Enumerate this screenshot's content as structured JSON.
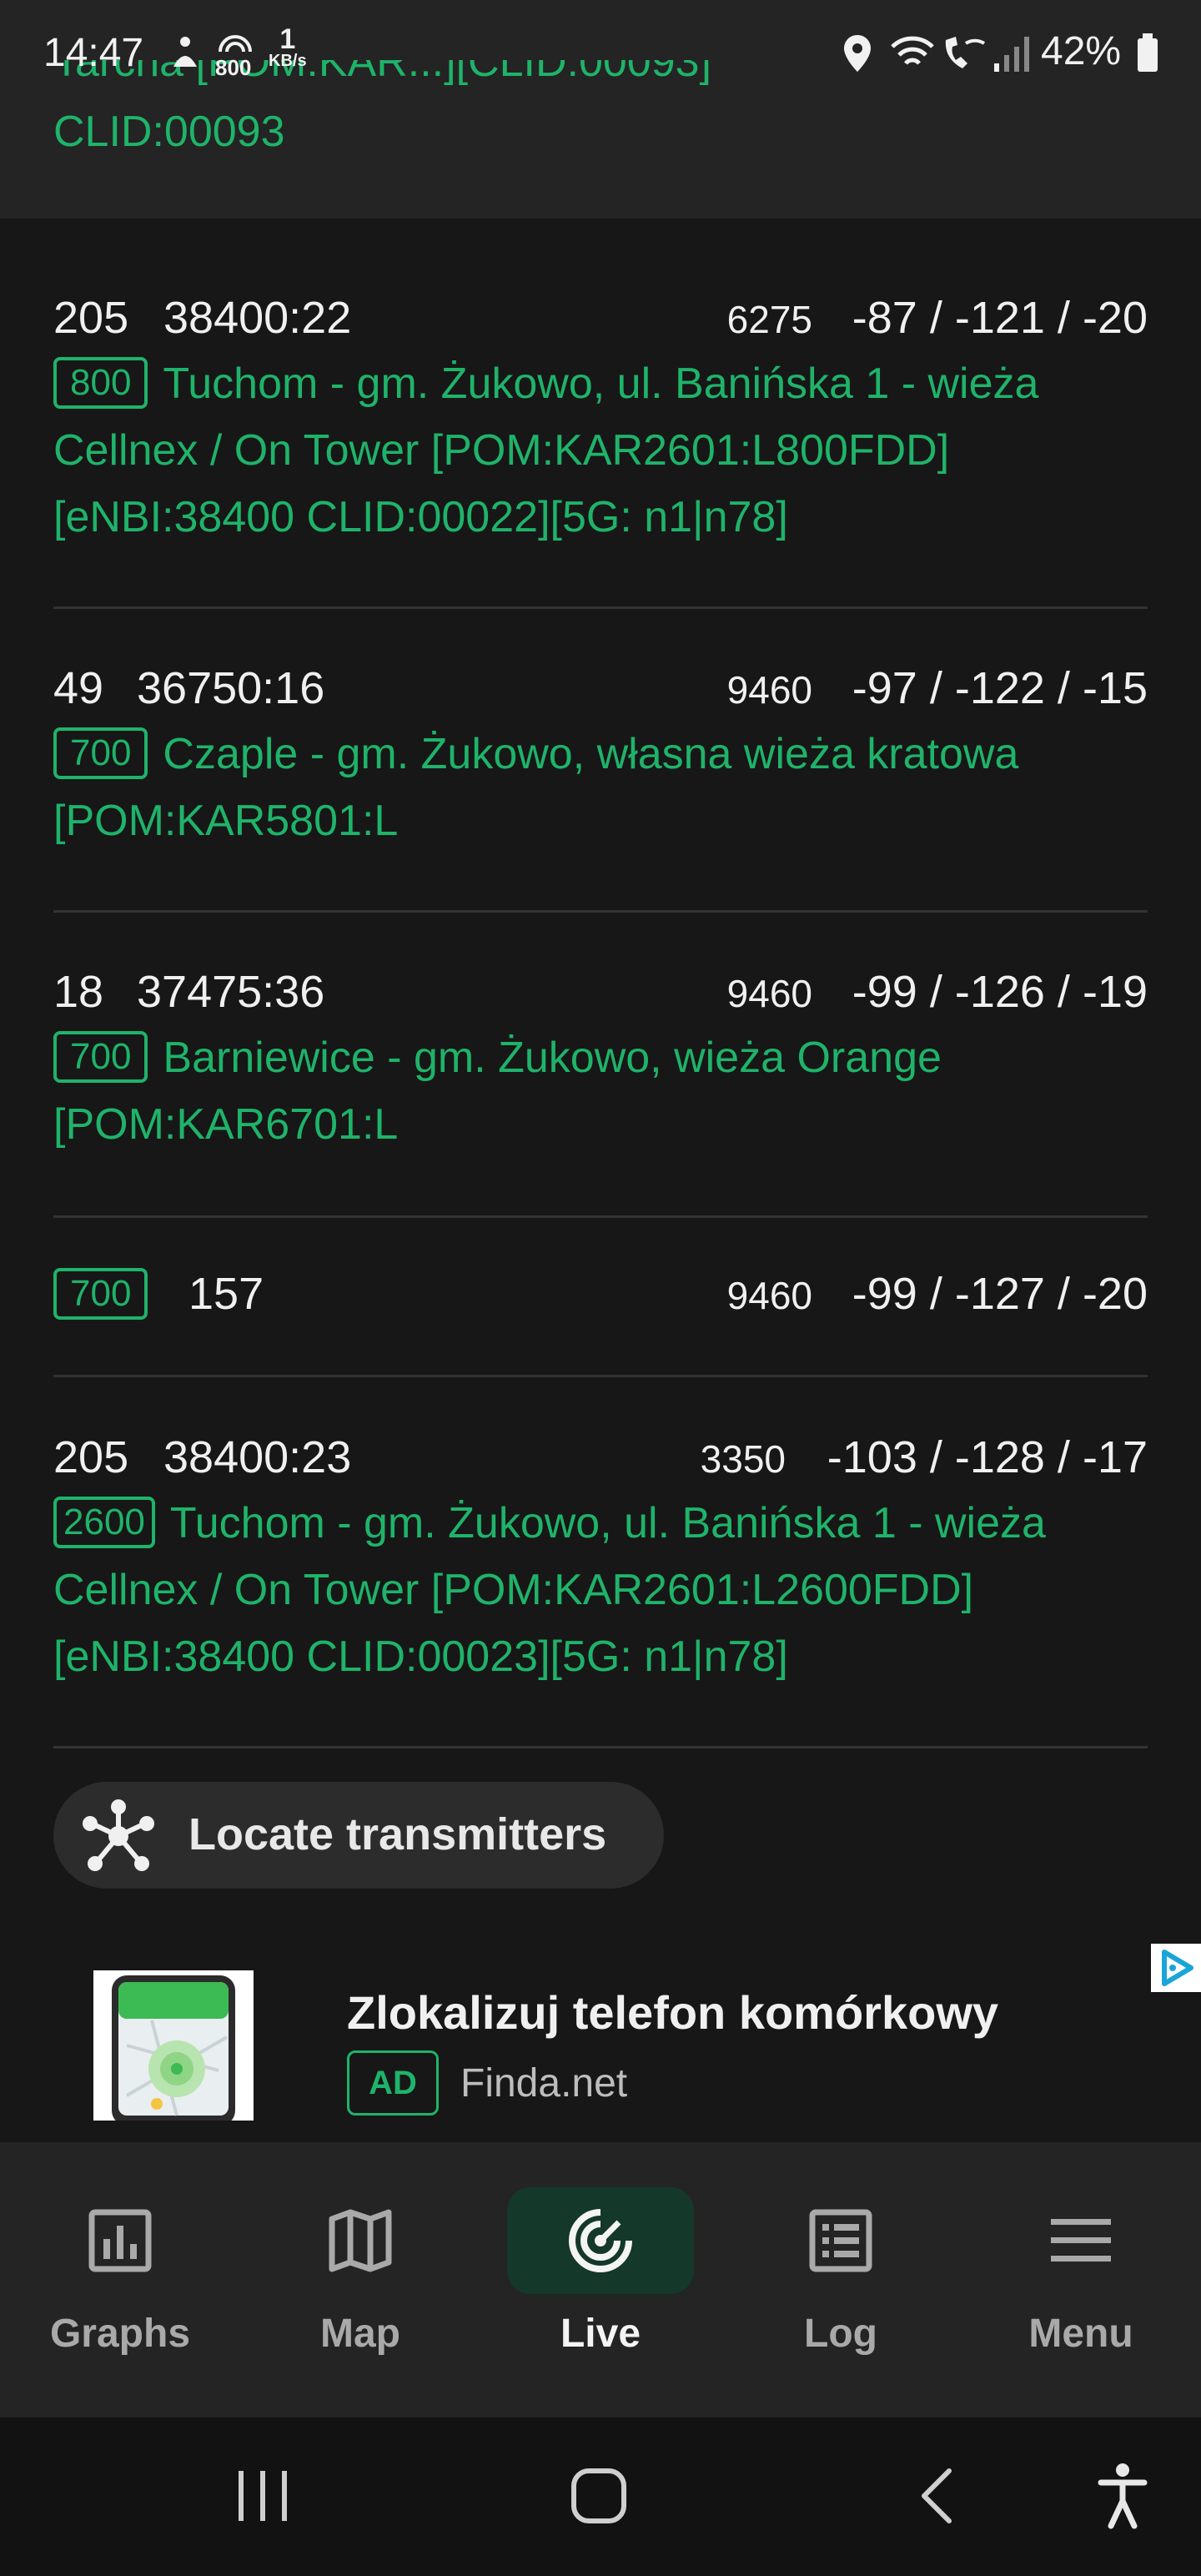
{
  "status_bar": {
    "time": "14:47",
    "net_speed_value": "1",
    "net_speed_unit": "KB/s",
    "signal_label": "800",
    "battery": "42%"
  },
  "top_card": {
    "clid_text": "CLID:00093"
  },
  "cells": [
    {
      "pci": "205",
      "cid": "38400:22",
      "earfcn": "6275",
      "signal": "-87 / -121 / -20",
      "band": "800",
      "site": "Tuchom - gm. Żukowo, ul. Banińska 1 - wieża Cellnex / On Tower [POM:KAR2601:L800FDD] [eNBI:38400 CLID:00022][5G: n1|n78]"
    },
    {
      "pci": "49",
      "cid": "36750:16",
      "earfcn": "9460",
      "signal": "-97 / -122 / -15",
      "band": "700",
      "site": "Czaple - gm. Żukowo, własna wieża kratowa [POM:KAR5801:L"
    },
    {
      "pci": "18",
      "cid": "37475:36",
      "earfcn": "9460",
      "signal": "-99 / -126 / -19",
      "band": "700",
      "site": "Barniewice - gm. Żukowo, wieża Orange [POM:KAR6701:L"
    },
    {
      "band": "700",
      "pci": "157",
      "earfcn": "9460",
      "signal": "-99 / -127 / -20"
    },
    {
      "pci": "205",
      "cid": "38400:23",
      "earfcn": "3350",
      "signal": "-103 / -128 / -17",
      "band": "2600",
      "site": "Tuchom - gm. Żukowo, ul. Banińska 1 - wieża Cellnex / On Tower [POM:KAR2601:L2600FDD] [eNBI:38400 CLID:00023][5G: n1|n78]"
    }
  ],
  "locate": {
    "label": "Locate transmitters",
    "icon": "molecule-icon"
  },
  "ad": {
    "title": "Zlokalizuj telefon komórkowy",
    "badge": "AD",
    "domain": "Finda.net"
  },
  "bottom_nav": {
    "items": [
      {
        "label": "Graphs",
        "icon": "bar-chart-icon"
      },
      {
        "label": "Map",
        "icon": "map-icon"
      },
      {
        "label": "Live",
        "icon": "radar-icon",
        "active": true
      },
      {
        "label": "Log",
        "icon": "list-icon"
      },
      {
        "label": "Menu",
        "icon": "hamburger-icon"
      }
    ]
  },
  "colors": {
    "accent": "#1fb36a",
    "background": "#171717",
    "active_pill": "#14382a"
  }
}
